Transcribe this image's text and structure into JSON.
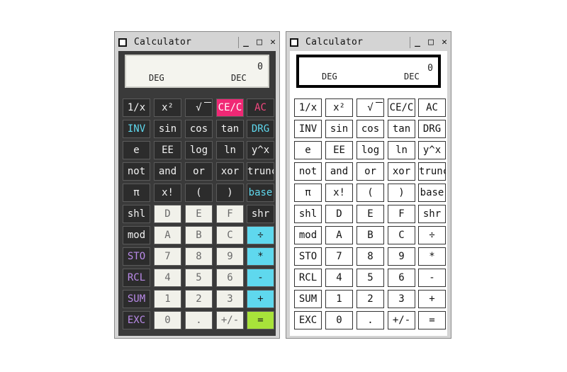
{
  "windows": [
    {
      "id": "left",
      "title": "Calculator",
      "display": {
        "value": "0",
        "angle_mode": "DEG",
        "base_mode": "DEC"
      },
      "keys": [
        [
          {
            "label": "1/x",
            "style": "dark"
          },
          {
            "label": "x²",
            "style": "dark"
          },
          {
            "label": "√",
            "style": "dark"
          },
          {
            "label": "CE/C",
            "style": "pink"
          },
          {
            "label": "AC",
            "style": "redtxt"
          }
        ],
        [
          {
            "label": "INV",
            "style": "cyantxt"
          },
          {
            "label": "sin",
            "style": "dark"
          },
          {
            "label": "cos",
            "style": "dark"
          },
          {
            "label": "tan",
            "style": "dark"
          },
          {
            "label": "DRG",
            "style": "cyantxt"
          }
        ],
        [
          {
            "label": "e",
            "style": "dark"
          },
          {
            "label": "EE",
            "style": "dark"
          },
          {
            "label": "log",
            "style": "dark"
          },
          {
            "label": "ln",
            "style": "dark"
          },
          {
            "label": "y^x",
            "style": "dark"
          }
        ],
        [
          {
            "label": "not",
            "style": "dark"
          },
          {
            "label": "and",
            "style": "dark"
          },
          {
            "label": "or",
            "style": "dark"
          },
          {
            "label": "xor",
            "style": "dark"
          },
          {
            "label": "trunc",
            "style": "dark"
          }
        ],
        [
          {
            "label": "π",
            "style": "dark"
          },
          {
            "label": "x!",
            "style": "dark"
          },
          {
            "label": "(",
            "style": "dark"
          },
          {
            "label": ")",
            "style": "dark"
          },
          {
            "label": "base",
            "style": "cyantxt"
          }
        ],
        [
          {
            "label": "shl",
            "style": "dark"
          },
          {
            "label": "D",
            "style": "light"
          },
          {
            "label": "E",
            "style": "light"
          },
          {
            "label": "F",
            "style": "light"
          },
          {
            "label": "shr",
            "style": "dark"
          }
        ],
        [
          {
            "label": "mod",
            "style": "dark"
          },
          {
            "label": "A",
            "style": "light"
          },
          {
            "label": "B",
            "style": "light"
          },
          {
            "label": "C",
            "style": "light"
          },
          {
            "label": "÷",
            "style": "cyanbg"
          }
        ],
        [
          {
            "label": "STO",
            "style": "purple"
          },
          {
            "label": "7",
            "style": "light"
          },
          {
            "label": "8",
            "style": "light"
          },
          {
            "label": "9",
            "style": "light"
          },
          {
            "label": "*",
            "style": "cyanbg"
          }
        ],
        [
          {
            "label": "RCL",
            "style": "purple"
          },
          {
            "label": "4",
            "style": "light"
          },
          {
            "label": "5",
            "style": "light"
          },
          {
            "label": "6",
            "style": "light"
          },
          {
            "label": "-",
            "style": "cyanbg"
          }
        ],
        [
          {
            "label": "SUM",
            "style": "purple"
          },
          {
            "label": "1",
            "style": "light"
          },
          {
            "label": "2",
            "style": "light"
          },
          {
            "label": "3",
            "style": "light"
          },
          {
            "label": "+",
            "style": "cyanbg"
          }
        ],
        [
          {
            "label": "EXC",
            "style": "purple"
          },
          {
            "label": "0",
            "style": "light"
          },
          {
            "label": ".",
            "style": "light"
          },
          {
            "label": "+/-",
            "style": "light"
          },
          {
            "label": "=",
            "style": "greenbg"
          }
        ]
      ]
    },
    {
      "id": "right",
      "title": "Calculator",
      "display": {
        "value": "0",
        "angle_mode": "DEG",
        "base_mode": "DEC"
      },
      "keys": [
        [
          {
            "label": "1/x"
          },
          {
            "label": "x²"
          },
          {
            "label": "√"
          },
          {
            "label": "CE/C"
          },
          {
            "label": "AC"
          }
        ],
        [
          {
            "label": "INV"
          },
          {
            "label": "sin"
          },
          {
            "label": "cos"
          },
          {
            "label": "tan"
          },
          {
            "label": "DRG"
          }
        ],
        [
          {
            "label": "e"
          },
          {
            "label": "EE"
          },
          {
            "label": "log"
          },
          {
            "label": "ln"
          },
          {
            "label": "y^x"
          }
        ],
        [
          {
            "label": "not"
          },
          {
            "label": "and"
          },
          {
            "label": "or"
          },
          {
            "label": "xor"
          },
          {
            "label": "trunc"
          }
        ],
        [
          {
            "label": "π"
          },
          {
            "label": "x!"
          },
          {
            "label": "("
          },
          {
            "label": ")"
          },
          {
            "label": "base"
          }
        ],
        [
          {
            "label": "shl"
          },
          {
            "label": "D"
          },
          {
            "label": "E"
          },
          {
            "label": "F"
          },
          {
            "label": "shr"
          }
        ],
        [
          {
            "label": "mod"
          },
          {
            "label": "A"
          },
          {
            "label": "B"
          },
          {
            "label": "C"
          },
          {
            "label": "÷"
          }
        ],
        [
          {
            "label": "STO"
          },
          {
            "label": "7"
          },
          {
            "label": "8"
          },
          {
            "label": "9"
          },
          {
            "label": "*"
          }
        ],
        [
          {
            "label": "RCL"
          },
          {
            "label": "4"
          },
          {
            "label": "5"
          },
          {
            "label": "6"
          },
          {
            "label": "-"
          }
        ],
        [
          {
            "label": "SUM"
          },
          {
            "label": "1"
          },
          {
            "label": "2"
          },
          {
            "label": "3"
          },
          {
            "label": "+"
          }
        ],
        [
          {
            "label": "EXC"
          },
          {
            "label": "0"
          },
          {
            "label": "."
          },
          {
            "label": "+/-"
          },
          {
            "label": "="
          }
        ]
      ]
    }
  ],
  "titlebar_icons": {
    "menu": "window-menu-icon",
    "minimize": "minimize-icon",
    "maximize": "maximize-icon",
    "close": "close-icon"
  },
  "titlebar_glyphs": {
    "minimize": "_",
    "maximize": "□",
    "close": "✕"
  }
}
